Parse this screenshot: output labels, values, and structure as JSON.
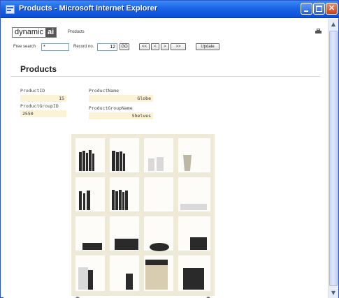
{
  "window": {
    "title": "Products - Microsoft Internet Explorer"
  },
  "header": {
    "logo_left": "dynamic",
    "logo_right": "ai",
    "breadcrumb": "Products"
  },
  "toolbar": {
    "free_search_label": "Free search",
    "free_search_value": "*",
    "record_label": "Record no.",
    "record_value": "12",
    "go_label": "GO",
    "nav_first": "<<",
    "nav_prev": "<",
    "nav_next": ">",
    "nav_last": ">>",
    "update_label": "Update"
  },
  "page": {
    "title": "Products"
  },
  "fields": {
    "product_id_label": "ProductID",
    "product_id_value": "15",
    "product_name_label": "ProductName",
    "product_name_value": "Globe",
    "product_group_id_label": "ProductGroupID",
    "product_group_id_value": "2550",
    "product_group_name_label": "ProductGroupName",
    "product_group_name_value": "Shelves"
  },
  "image": {
    "subject": "bookshelf"
  },
  "colors": {
    "titlebar": "#1c64e6",
    "field_bg": "#fcf3d6",
    "frame": "#ece6d2"
  }
}
